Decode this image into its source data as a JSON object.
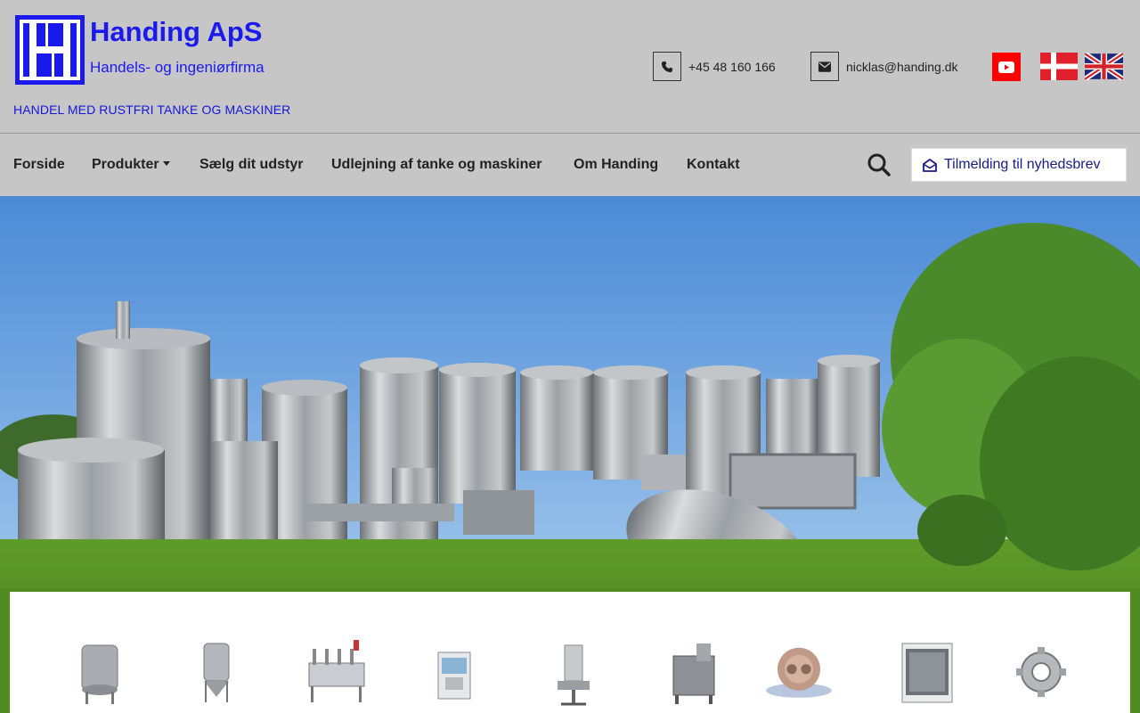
{
  "brand": {
    "title": "Handing ApS",
    "subtitle": "Handels- og ingeniørfirma",
    "tagline": "HANDEL MED RUSTFRI TANKE OG MASKINER"
  },
  "contact": {
    "phone": "+45 48 160 166",
    "email": "nicklas@handing.dk"
  },
  "icons": {
    "phone": "phone-icon",
    "email": "envelope-icon",
    "youtube": "youtube-icon",
    "search": "search-icon",
    "newsletter": "envelope-open-icon"
  },
  "nav": {
    "items": [
      {
        "label": "Forside"
      },
      {
        "label": "Produkter",
        "has_dropdown": true
      },
      {
        "label": "Sælg dit udstyr"
      },
      {
        "label": "Udlejning af tanke og maskiner"
      },
      {
        "label": "Om Handing"
      },
      {
        "label": "Kontakt"
      }
    ],
    "newsletter_label": "Tilmelding til nyhedsbrev"
  },
  "languages": [
    "Danish",
    "English"
  ],
  "products": [
    "stainless-tank-icon",
    "conical-tank-icon",
    "filling-line-icon",
    "filling-machine-icon",
    "capping-machine-icon",
    "mixer-icon",
    "lobe-pump-icon",
    "oven-icon",
    "gear-icon"
  ],
  "colors": {
    "brand_blue": "#1a1aee",
    "header_bg": "#c6c6c6",
    "youtube_red": "#ff0000"
  }
}
